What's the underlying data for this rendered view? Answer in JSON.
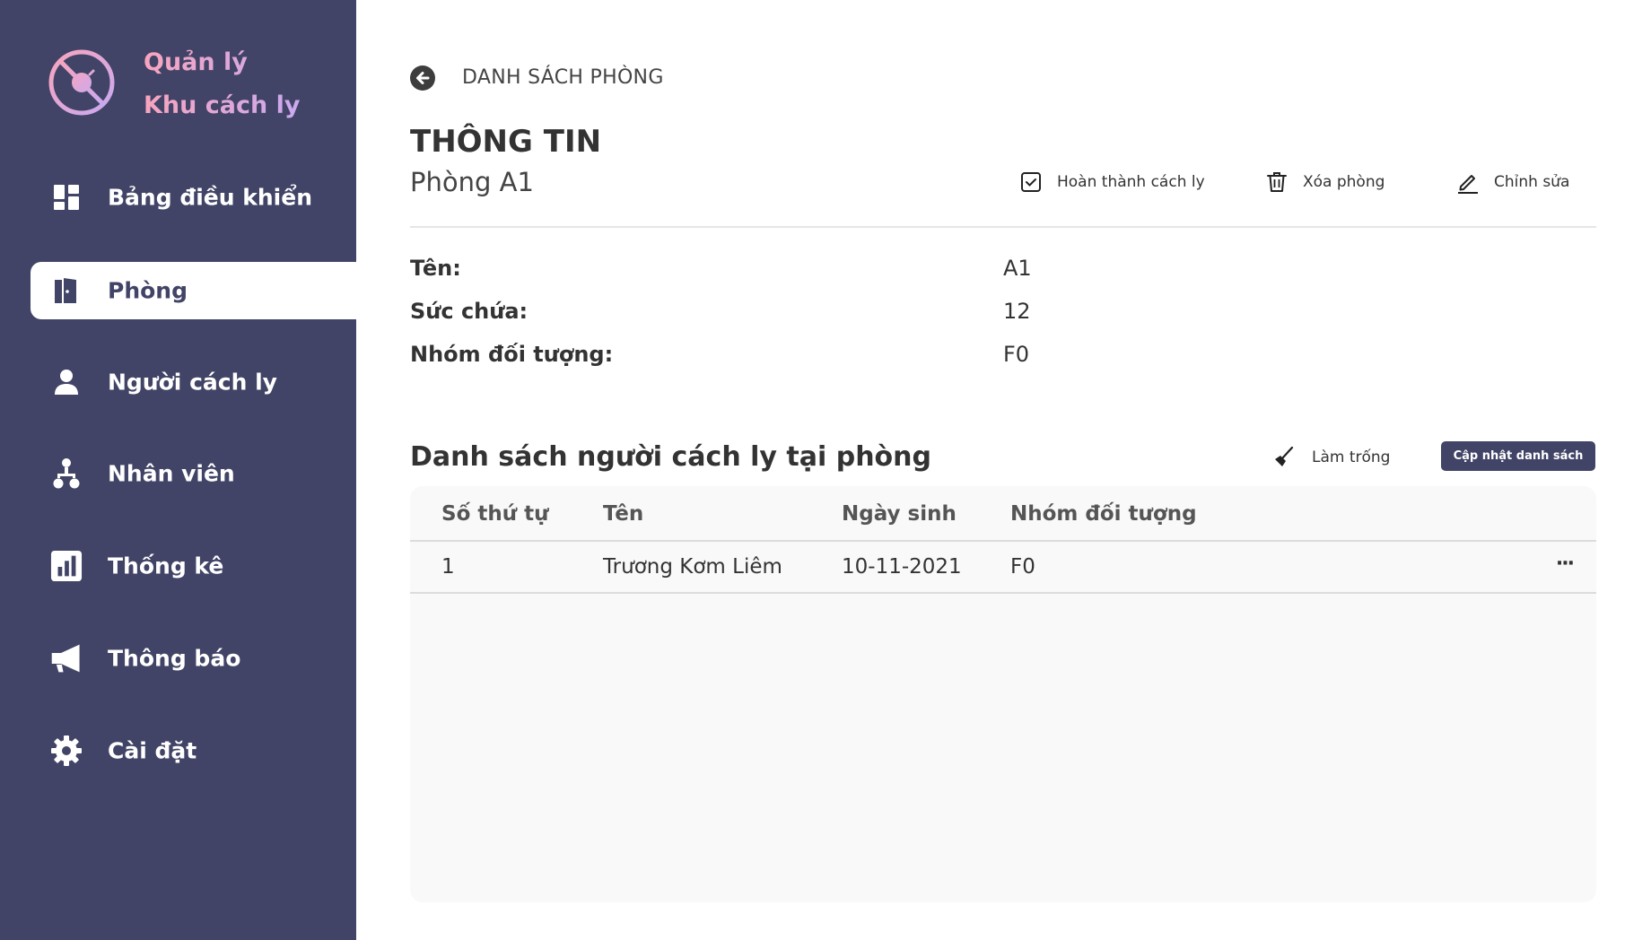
{
  "sidebar": {
    "brand_line1": "Quản lý",
    "brand_line2": "Khu cách ly",
    "logo_icon": "virus-blocked-icon",
    "items": [
      {
        "label": "Bảng điều khiển",
        "icon": "dashboard-icon"
      },
      {
        "label": "Phòng",
        "icon": "door-icon",
        "active": true
      },
      {
        "label": "Người cách ly",
        "icon": "person-icon"
      },
      {
        "label": "Nhân viên",
        "icon": "org-chart-icon"
      },
      {
        "label": "Thống kê",
        "icon": "bar-chart-icon"
      },
      {
        "label": "Thông báo",
        "icon": "megaphone-icon"
      },
      {
        "label": "Cài đặt",
        "icon": "gear-icon"
      }
    ]
  },
  "header": {
    "breadcrumb": "DANH SÁCH PHÒNG",
    "title": "THÔNG TIN",
    "subtitle": "Phòng A1"
  },
  "actions": {
    "complete": "Hoàn thành cách ly",
    "delete": "Xóa phòng",
    "edit": "Chỉnh sửa"
  },
  "info": [
    {
      "label": "Tên:",
      "value": "A1"
    },
    {
      "label": "Sức chứa:",
      "value": "12"
    },
    {
      "label": "Nhóm đối tượng:",
      "value": "F0"
    }
  ],
  "list": {
    "title": "Danh sách người cách ly tại phòng",
    "clear_label": "Làm trống",
    "update_label": "Cập nhật danh sách",
    "columns": [
      "Số thứ tự",
      "Tên",
      "Ngày sinh",
      "Nhóm đối tượng"
    ],
    "rows": [
      {
        "index": "1",
        "name": "Trương Kơm Liêm",
        "dob": "10-11-2021",
        "group": "F0",
        "more": "···"
      }
    ]
  },
  "colors": {
    "sidebar": "#414466",
    "brand_gradient_start": "#f8a5be",
    "brand_gradient_end": "#c9a9f0",
    "button": "#414466"
  }
}
